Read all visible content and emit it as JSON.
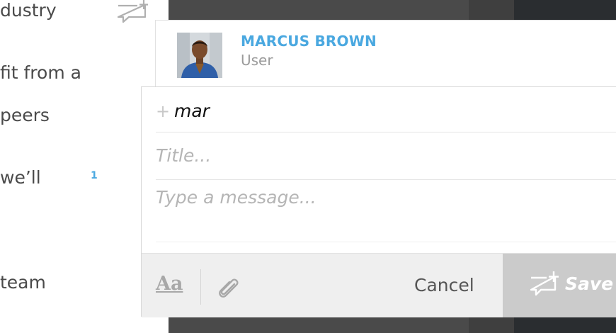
{
  "document": {
    "lines": [
      "dustry",
      "fit from a",
      "peers",
      "we’ll",
      "team"
    ],
    "comment_count": "1"
  },
  "mention_suggestions": [
    {
      "name": "MARCUS BROWN",
      "role": "User"
    }
  ],
  "compose": {
    "recipient_value": "mar",
    "title_placeholder": "Title...",
    "message_placeholder": "Type a message...",
    "format_label": "Aa",
    "cancel_label": "Cancel",
    "save_label": "Save"
  },
  "colors": {
    "accent": "#4aa8e0",
    "save_bg": "#cbcbcb",
    "toolbar_bg": "#efefef",
    "dark_panel": "#4a4a4a"
  },
  "icons": [
    "add-comment-icon",
    "plus-icon",
    "paperclip-icon",
    "save-comment-icon"
  ]
}
